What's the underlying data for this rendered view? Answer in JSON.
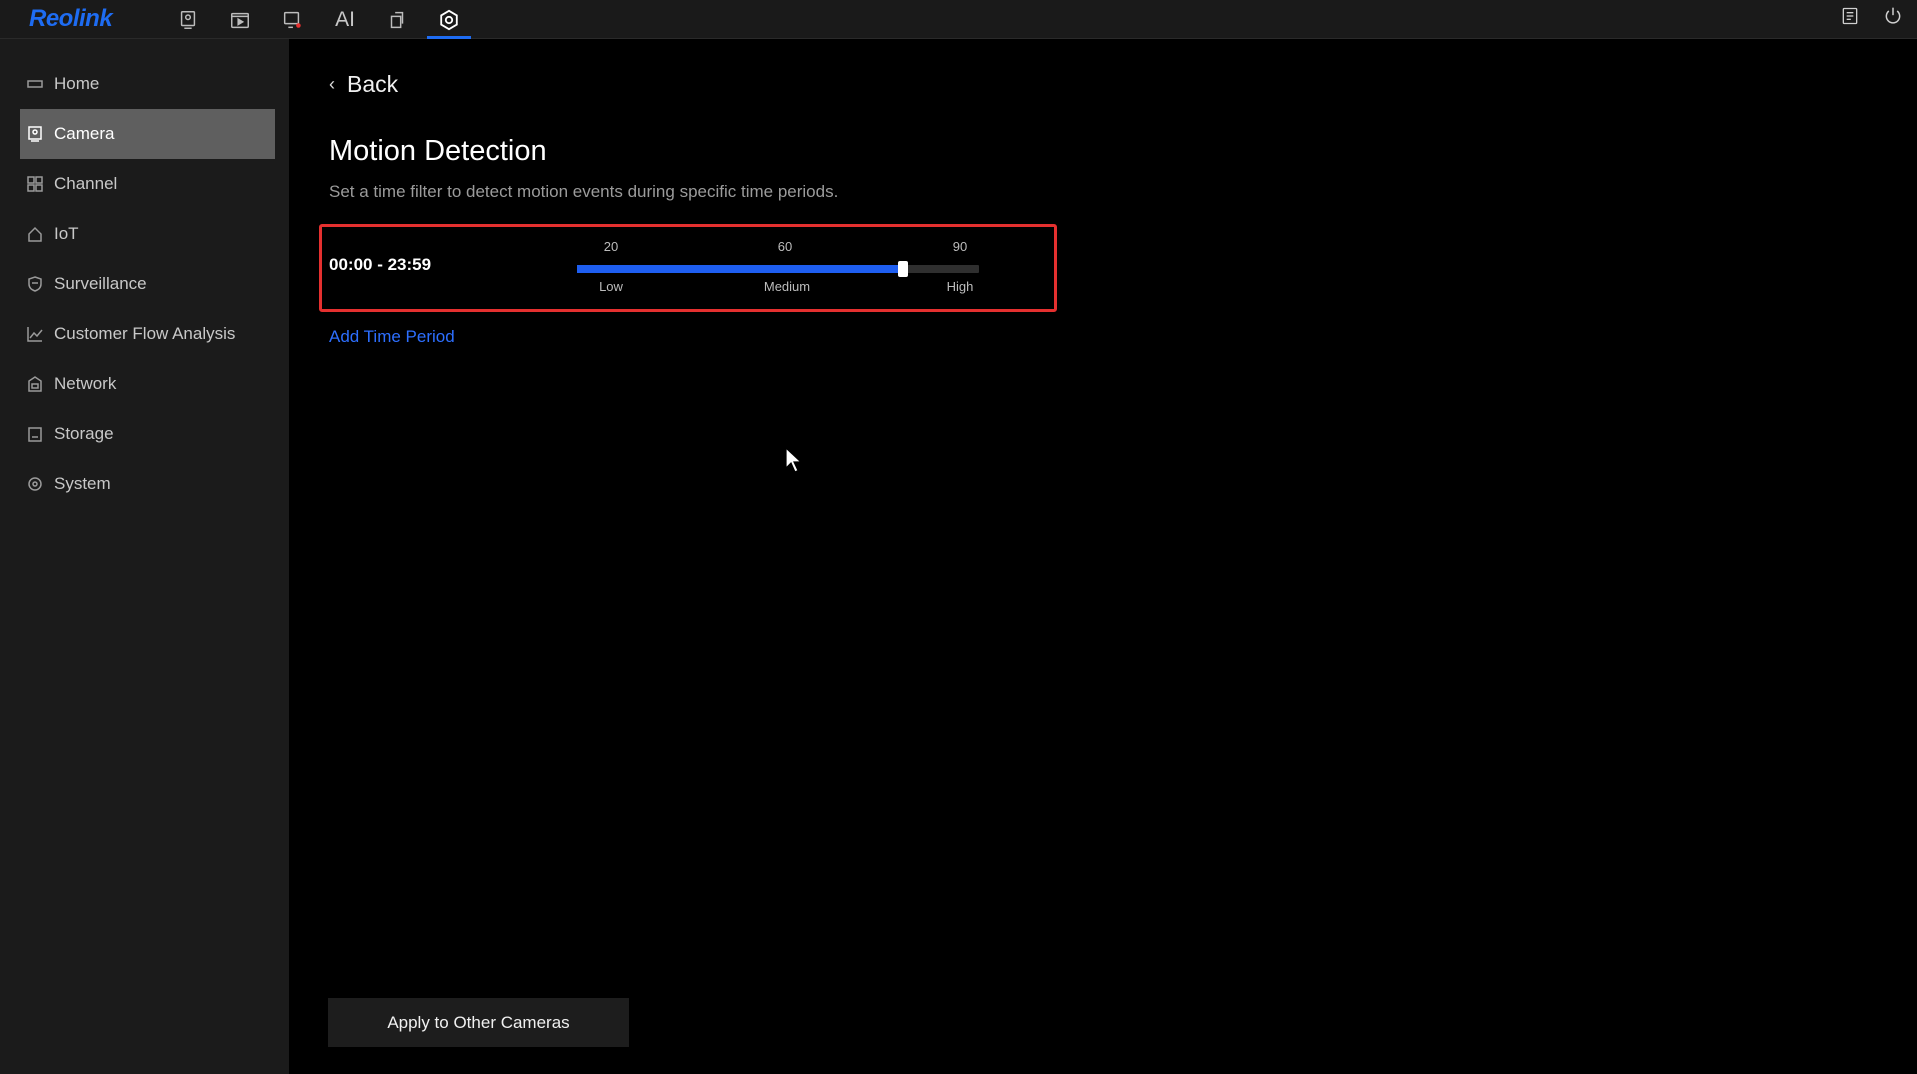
{
  "brand": {
    "logo": "Reolink",
    "accent": "#1e6cf2"
  },
  "topnav": {
    "items": [
      {
        "name": "live-view-icon"
      },
      {
        "name": "playback-icon"
      },
      {
        "name": "alarm-icon"
      },
      {
        "name": "ai-tab",
        "label": "AI"
      },
      {
        "name": "devices-icon"
      },
      {
        "name": "settings-icon",
        "active": true
      }
    ],
    "right": [
      {
        "name": "notes-icon"
      },
      {
        "name": "power-icon"
      }
    ]
  },
  "sidebar": {
    "items": [
      {
        "label": "Home",
        "icon": "home-rect-icon"
      },
      {
        "label": "Camera",
        "icon": "camera-icon",
        "active": true
      },
      {
        "label": "Channel",
        "icon": "grid-icon"
      },
      {
        "label": "IoT",
        "icon": "house-icon"
      },
      {
        "label": "Surveillance",
        "icon": "shield-icon"
      },
      {
        "label": "Customer Flow Analysis",
        "icon": "chart-icon"
      },
      {
        "label": "Network",
        "icon": "network-icon"
      },
      {
        "label": "Storage",
        "icon": "storage-icon"
      },
      {
        "label": "System",
        "icon": "gear-icon"
      }
    ]
  },
  "main": {
    "back_label": "Back",
    "title": "Motion Detection",
    "subtitle": "Set a time filter to detect motion events during specific time periods.",
    "period": {
      "time_range": "00:00 - 23:59",
      "ticks_top": [
        "20",
        "60",
        "90"
      ],
      "ticks_bottom": [
        "Low",
        "Medium",
        "High"
      ],
      "value_fraction": 0.81
    },
    "add_period_label": "Add Time Period",
    "apply_label": "Apply to Other Cameras"
  },
  "colors": {
    "highlight_border": "#e5302f",
    "slider_fill": "#1e5ef0",
    "link": "#2d6fff"
  }
}
